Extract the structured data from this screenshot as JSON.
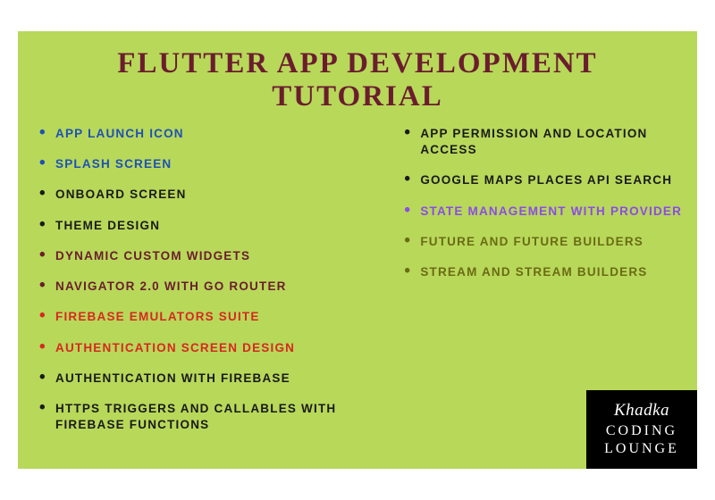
{
  "title": "FLUTTER APP DEVELOPMENT TUTORIAL",
  "left_items": [
    {
      "label": "APP LAUNCH ICON",
      "color": "c-blue"
    },
    {
      "label": "SPLASH SCREEN",
      "color": "c-blue"
    },
    {
      "label": "ONBOARD SCREEN",
      "color": "c-black"
    },
    {
      "label": "THEME DESIGN",
      "color": "c-black"
    },
    {
      "label": "DYNAMIC CUSTOM WIDGETS",
      "color": "c-maroon"
    },
    {
      "label": "NAVIGATOR 2.0 WITH GO ROUTER",
      "color": "c-maroon"
    },
    {
      "label": "FIREBASE EMULATORS SUITE",
      "color": "c-red"
    },
    {
      "label": "AUTHENTICATION SCREEN DESIGN",
      "color": "c-red"
    },
    {
      "label": "AUTHENTICATION WITH FIREBASE",
      "color": "c-black"
    },
    {
      "label": "HTTPS TRIGGERS AND CALLABLES WITH FIREBASE FUNCTIONS",
      "color": "c-black"
    }
  ],
  "right_items": [
    {
      "label": "APP PERMISSION AND LOCATION ACCESS",
      "color": "c-black"
    },
    {
      "label": "GOOGLE MAPS PLACES API SEARCH",
      "color": "c-black"
    },
    {
      "label": "STATE MANAGEMENT WITH PROVIDER",
      "color": "c-purple"
    },
    {
      "label": "FUTURE AND FUTURE BUILDERS",
      "color": "c-olive"
    },
    {
      "label": "STREAM AND STREAM BUILDERS",
      "color": "c-olive"
    }
  ],
  "logo": {
    "script": "Khadka",
    "line1": "CODING",
    "line2": "LOUNGE"
  }
}
